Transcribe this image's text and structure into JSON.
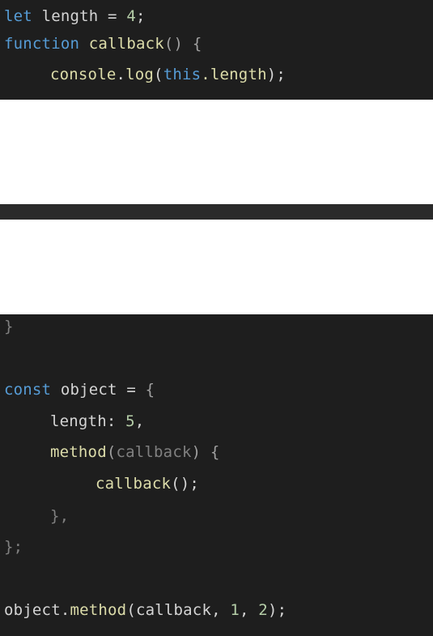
{
  "top_panel": {
    "line1": {
      "kw": "let",
      "name": "length",
      "op": "=",
      "value": "4",
      "end": ";"
    },
    "line2": {
      "kw": "function",
      "name": "callback",
      "parens": "()",
      "brace": "{"
    },
    "line3": {
      "obj": "console",
      "dot": ".",
      "method": "log",
      "open": "(",
      "this": "this",
      "prop": ".length",
      "close": ");"
    }
  },
  "bottom_panel": {
    "line1": {
      "brace": "}"
    },
    "line2": {
      "kw": "const",
      "name": "object",
      "op": "=",
      "brace": "{"
    },
    "line3": {
      "key": "length:",
      "value": "5",
      "comma": ","
    },
    "line4": {
      "method": "method",
      "open": "(",
      "param": "callback",
      "close": ")",
      "brace": "{"
    },
    "line5": {
      "call": "callback",
      "parens": "();"
    },
    "line6": {
      "text": "},"
    },
    "line7": {
      "text": "};"
    },
    "line8": {
      "obj": "object",
      "dot": ".",
      "method": "method",
      "open": "(",
      "arg1": "callback",
      "sep1": ", ",
      "arg2": "1",
      "sep2": ", ",
      "arg3": "2",
      "close": ");"
    }
  }
}
